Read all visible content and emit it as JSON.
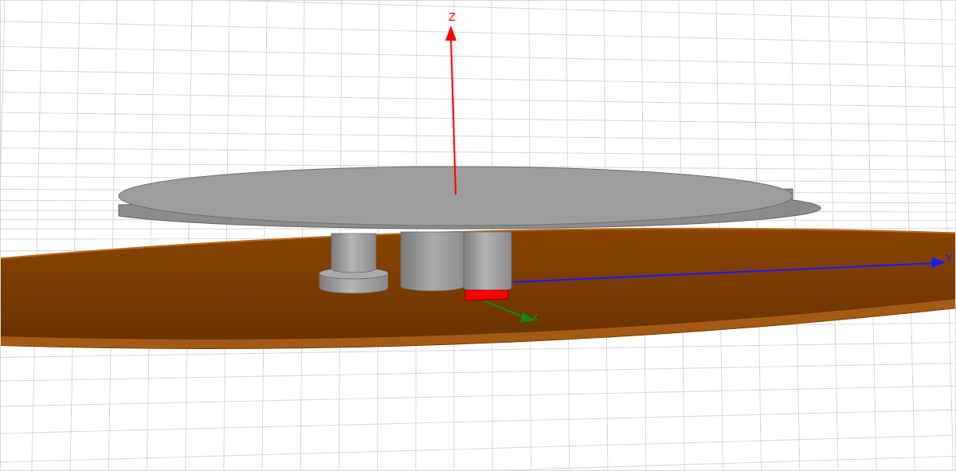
{
  "viewport": {
    "axes": {
      "z": {
        "label": "Z",
        "color": "#ff0000"
      },
      "y": {
        "label": "Y",
        "color": "#1a1aff"
      },
      "x": {
        "label": "X",
        "color": "#0c8a0c"
      }
    },
    "colors": {
      "background": "#ffffff",
      "grid_line": "#d6d6d6",
      "ground_plane_fill": "#7a3a00",
      "ground_plane_edge": "#a55a10",
      "patch_top": "#9b9b9b",
      "patch_side": "#8a8a8a",
      "feed_port": "#ff0000"
    }
  }
}
